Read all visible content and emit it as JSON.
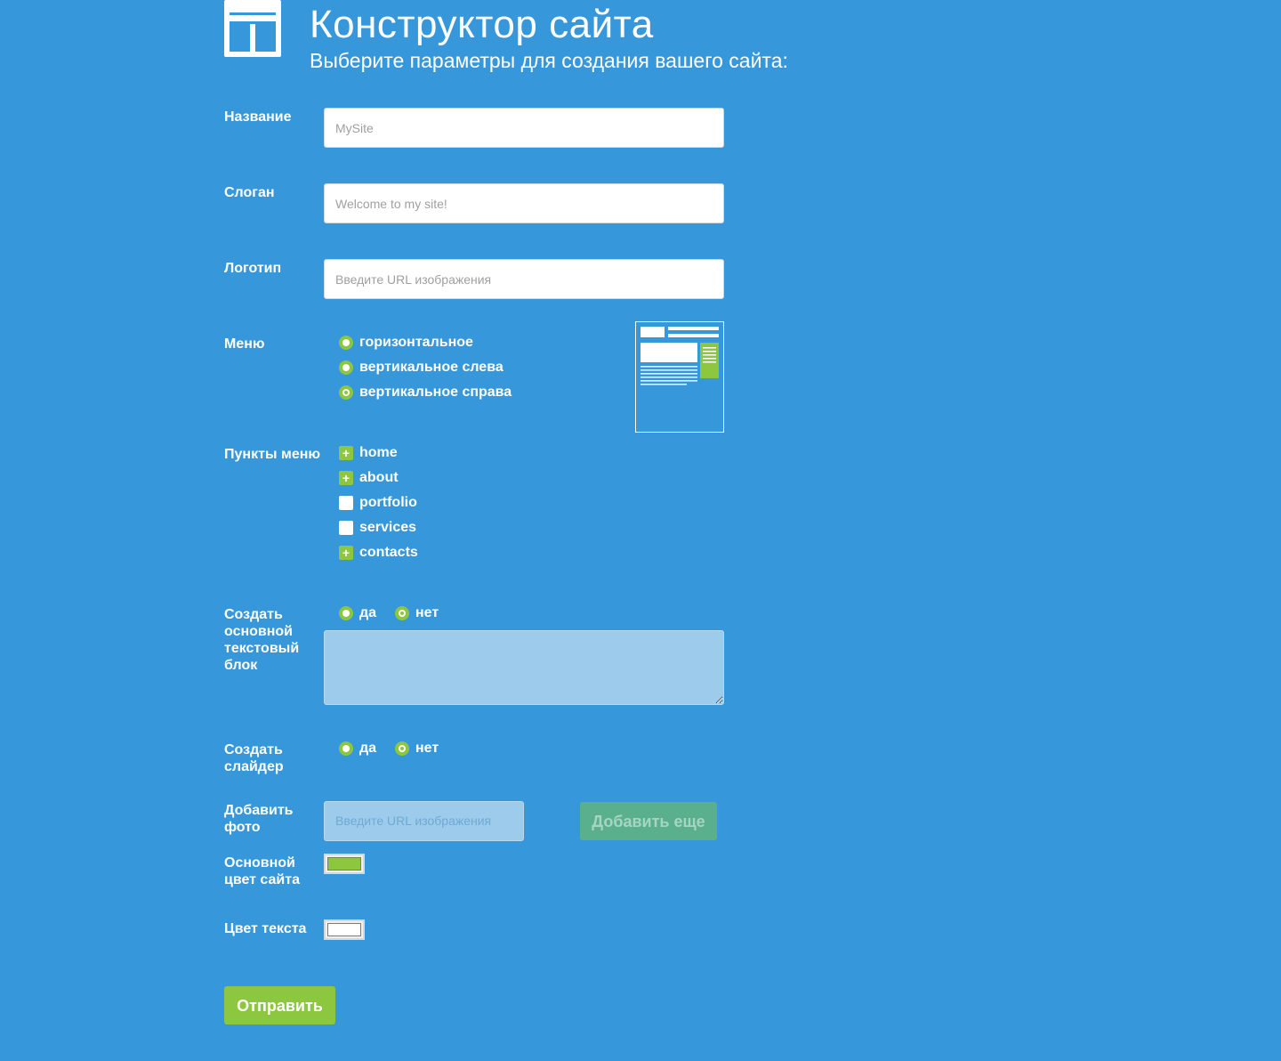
{
  "header": {
    "title": "Конструктор сайта",
    "subtitle": "Выберите параметры для создания вашего сайта:"
  },
  "fields": {
    "name": {
      "label": "Название",
      "placeholder": "MySite"
    },
    "slogan": {
      "label": "Слоган",
      "placeholder": "Welcome to my site!"
    },
    "logo": {
      "label": "Логотип",
      "placeholder": "Введите URL изображения"
    }
  },
  "menu": {
    "label": "Меню",
    "options": [
      {
        "label": "горизонтальное",
        "checked": false
      },
      {
        "label": "вертикальное слева",
        "checked": false
      },
      {
        "label": "вертикальное справа",
        "checked": true
      }
    ]
  },
  "menu_items": {
    "label": "Пункты меню",
    "items": [
      {
        "label": "home",
        "checked": true
      },
      {
        "label": "about",
        "checked": true
      },
      {
        "label": "portfolio",
        "checked": false
      },
      {
        "label": "services",
        "checked": false
      },
      {
        "label": "contacts",
        "checked": true
      }
    ]
  },
  "text_block": {
    "label_lines": [
      "Создать",
      "основной",
      "текстовый",
      "блок"
    ],
    "yes": "да",
    "no": "нет",
    "selected": "нет"
  },
  "slider": {
    "label_lines": [
      "Создать",
      "слайдер"
    ],
    "yes": "да",
    "no": "нет",
    "selected": "нет"
  },
  "photo": {
    "label_lines": [
      "Добавить",
      "фото"
    ],
    "placeholder": "Введите URL изображения",
    "add_more_label": "Добавить еще"
  },
  "main_color": {
    "label_lines": [
      "Основной",
      "цвет сайта"
    ],
    "value": "#8dc63f"
  },
  "text_color": {
    "label": "Цвет текста",
    "value": "#ffffff"
  },
  "submit_label": "Отправить",
  "colors": {
    "background": "#3797db",
    "accent": "#8dc63f"
  }
}
